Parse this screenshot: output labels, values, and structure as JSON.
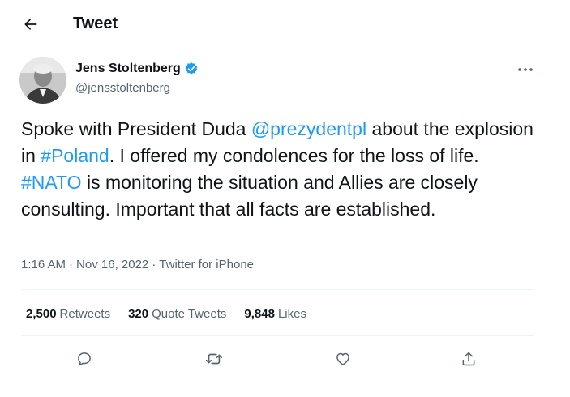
{
  "header": {
    "title": "Tweet",
    "back_icon": "arrow-left-icon"
  },
  "author": {
    "name": "Jens Stoltenberg",
    "handle": "@jensstoltenberg",
    "verified_icon": "verified-badge-icon",
    "verified_color": "#1d9bf0"
  },
  "more_icon": "more-horizontal-icon",
  "tweet": {
    "seg1": "Spoke with President Duda ",
    "mention": "@prezydentpl",
    "seg2": " about the explosion in ",
    "hashtag1": "#Poland",
    "seg3": ". I offered my condolences for the loss of life. ",
    "hashtag2": "#NATO",
    "seg4": " is monitoring the situation and Allies are closely consulting. Important that all facts are established."
  },
  "meta": {
    "time": "1:16 AM",
    "sep1": "·",
    "date": "Nov 16, 2022",
    "sep2": "·",
    "source": "Twitter for iPhone"
  },
  "stats": {
    "retweets_count": "2,500",
    "retweets_label": "Retweets",
    "quotes_count": "320",
    "quotes_label": "Quote Tweets",
    "likes_count": "9,848",
    "likes_label": "Likes"
  },
  "actions": [
    "reply-icon",
    "retweet-icon",
    "like-icon",
    "share-icon"
  ],
  "colors": {
    "link": "#1d9bf0",
    "secondary_text": "#536471",
    "primary_text": "#0f1419",
    "divider": "#eff3f4"
  }
}
